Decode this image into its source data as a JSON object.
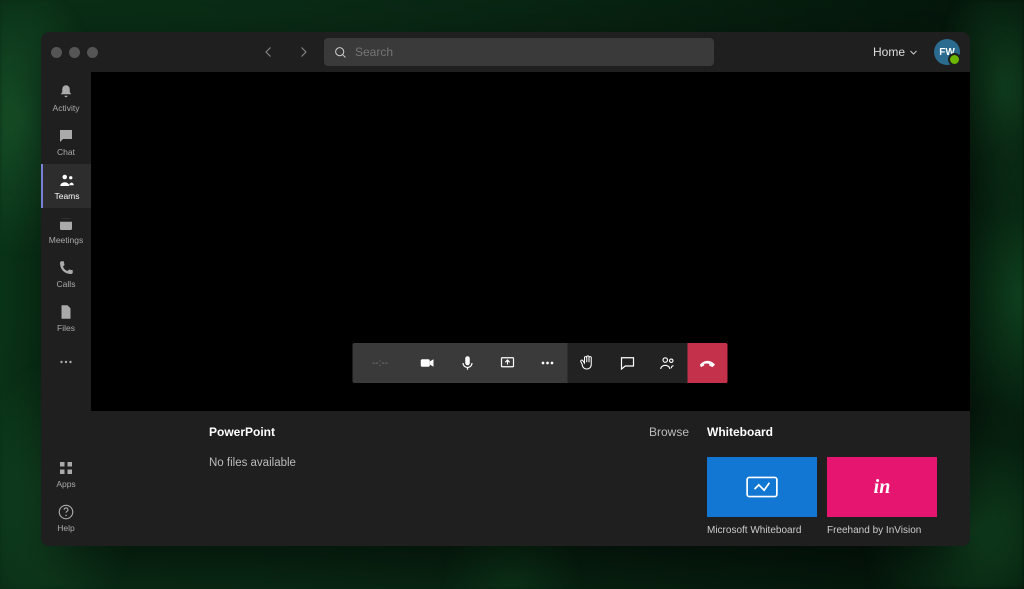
{
  "header": {
    "search_placeholder": "Search",
    "org_label": "Home",
    "avatar_initials": "FW"
  },
  "rail": {
    "items": [
      {
        "id": "activity",
        "label": "Activity"
      },
      {
        "id": "chat",
        "label": "Chat"
      },
      {
        "id": "teams",
        "label": "Teams"
      },
      {
        "id": "meetings",
        "label": "Meetings"
      },
      {
        "id": "calls",
        "label": "Calls"
      },
      {
        "id": "files",
        "label": "Files"
      }
    ],
    "active_id": "teams",
    "bottom": {
      "apps_label": "Apps",
      "help_label": "Help"
    }
  },
  "meeting": {
    "time_display": "--:--"
  },
  "share": {
    "powerpoint": {
      "title": "PowerPoint",
      "browse_label": "Browse",
      "empty_text": "No files available"
    },
    "whiteboard": {
      "title": "Whiteboard",
      "tiles": [
        {
          "id": "ms",
          "caption": "Microsoft Whiteboard",
          "color": "blue"
        },
        {
          "id": "invision",
          "caption": "Freehand by InVision",
          "color": "pink"
        }
      ]
    }
  }
}
